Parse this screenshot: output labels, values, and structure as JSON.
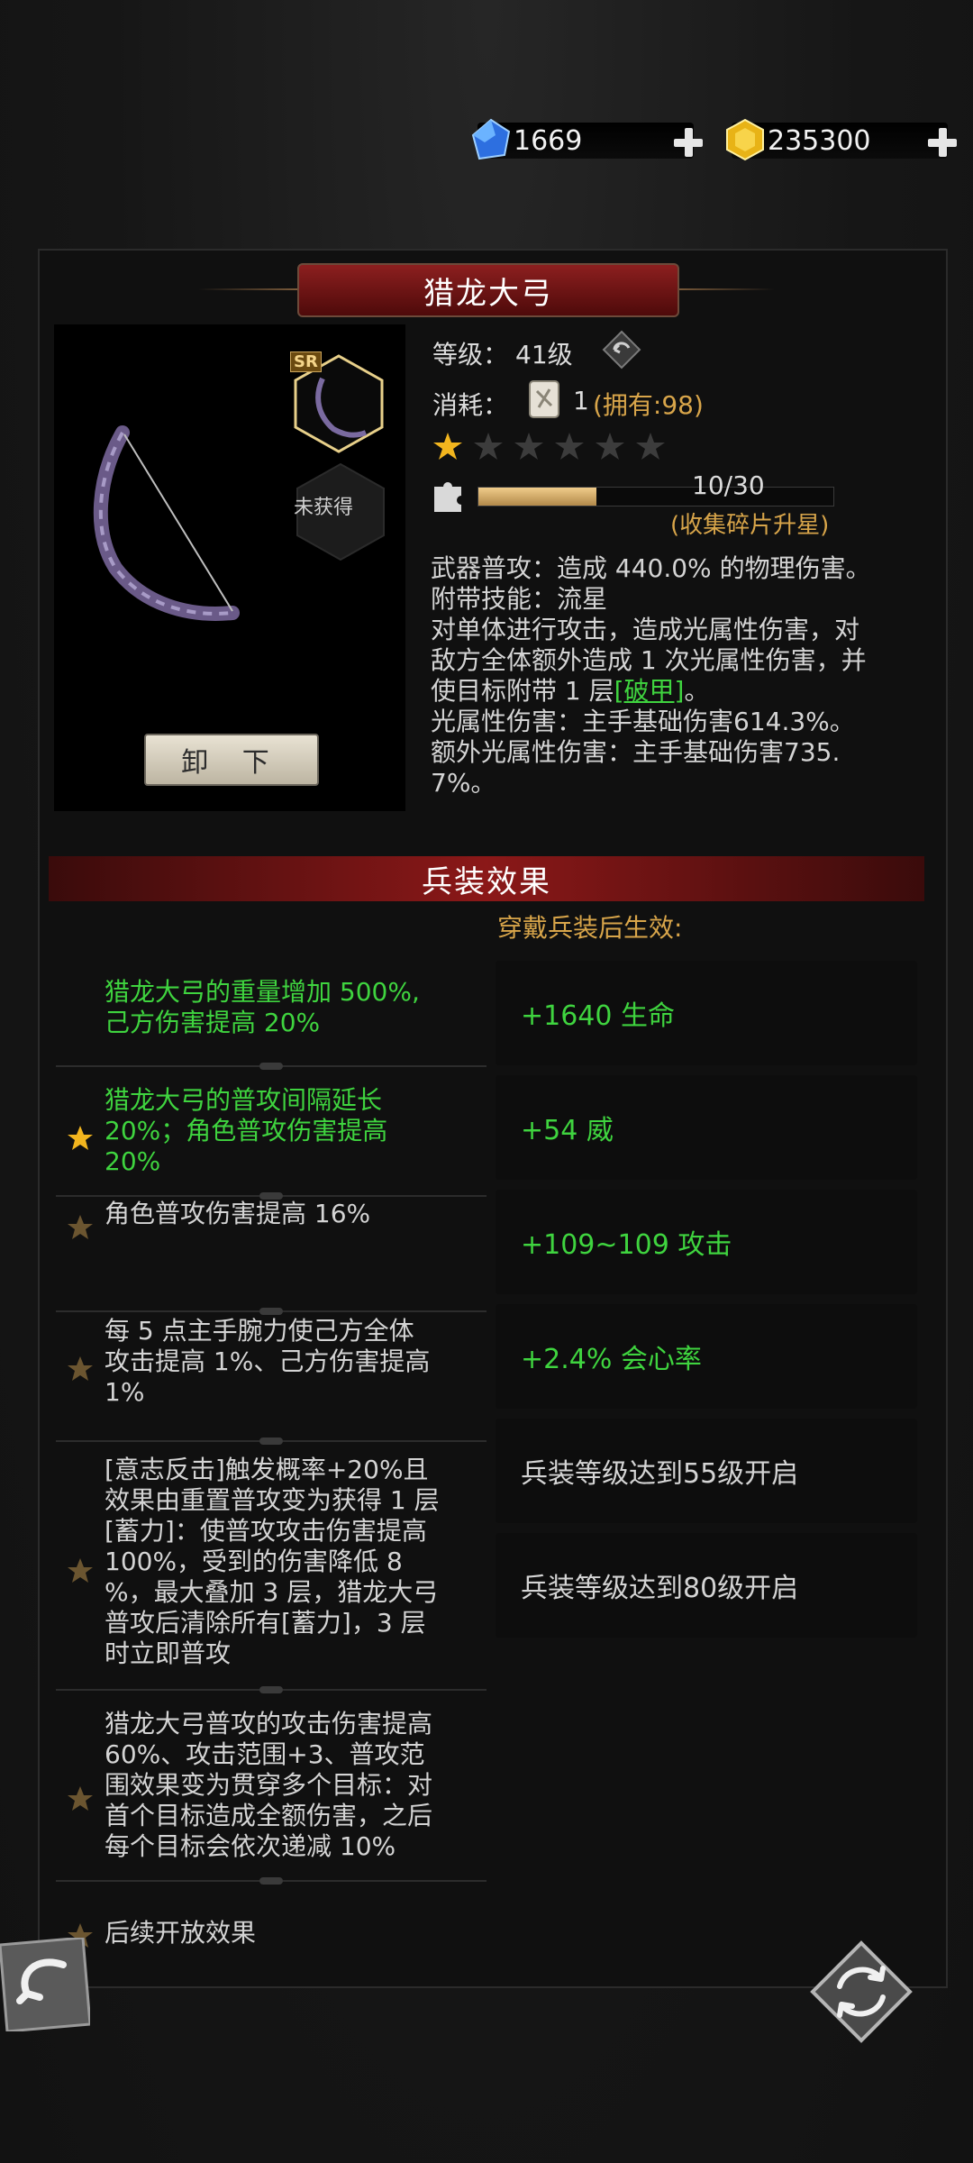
{
  "currency": {
    "diamond": "1669",
    "gold": "235300"
  },
  "weapon": {
    "title": "猎龙大弓",
    "rarity": "SR",
    "not_obtained": "未获得",
    "unequip_label": "卸 下",
    "level_label": "等级：",
    "level_value": "41级",
    "cost_label": "消耗：",
    "cost_amount": "1",
    "cost_owned": "(拥有:98)",
    "stars_total": 6,
    "stars_filled": 1,
    "fragments_text": "10/30",
    "fragments_value": 10,
    "fragments_max": 30,
    "fragments_hint": "(收集碎片升星)",
    "desc": {
      "line1": "武器普攻：造成 440.0% 的物理伤害。",
      "line2": "附带技能：流星",
      "line3": "对单体进行攻击，造成光属性伤害，对",
      "line4": "敌方全体额外造成 1 次光属性伤害，并",
      "line5a": "使目标附带 1 层",
      "line5link": "[破甲]",
      "line5b": "。",
      "line6": "光属性伤害：主手基础伤害614.3%。",
      "line7": "额外光属性伤害：主手基础伤害735.",
      "line8": "7%。"
    }
  },
  "effects": {
    "section_title": "兵装效果",
    "subtitle": "穿戴兵装后生效:",
    "rows": [
      {
        "text": [
          "猎龙大弓的重量增加 500%,",
          "己方伤害提高 20%"
        ]
      },
      {
        "text": [
          "猎龙大弓的普攻间隔延长",
          "20%；角色普攻伤害提高",
          "20%"
        ]
      },
      {
        "text": [
          "角色普攻伤害提高 16%"
        ]
      },
      {
        "text": [
          "每 5 点主手腕力使己方全体",
          "攻击提高 1%、己方伤害提高",
          "1%"
        ]
      },
      {
        "text": [
          "[意志反击]触发概率+20%且",
          "效果由重置普攻变为获得 1 层",
          "[蓄力]：使普攻攻击伤害提高",
          "100%，受到的伤害降低 8",
          "%，最大叠加 3 层，猎龙大弓",
          "普攻后清除所有[蓄力]，3 层",
          "时立即普攻"
        ]
      },
      {
        "text": [
          "猎龙大弓普攻的攻击伤害提高",
          "60%、攻击范围+3、普攻范",
          "围效果变为贯穿多个目标：对",
          "首个目标造成全额伤害，之后",
          "每个目标会依次递减 10%"
        ]
      },
      {
        "text": [
          "后续开放效果"
        ]
      }
    ],
    "attributes": [
      "+1640 生命",
      "+54 威",
      "+109~109 攻击",
      "+2.4% 会心率",
      "兵装等级达到55级开启",
      "兵装等级达到80级开启"
    ]
  },
  "colors": {
    "accent_green": "#3fd43f",
    "gold": "#d8a54a",
    "title_red": "#8b1818"
  }
}
